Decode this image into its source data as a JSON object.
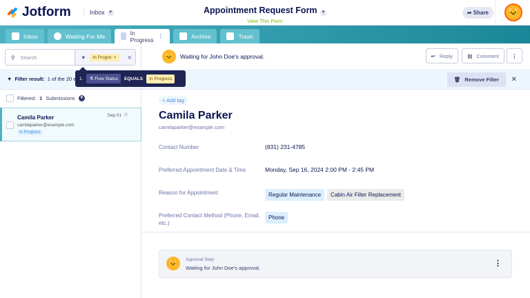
{
  "header": {
    "logo": "Jotform",
    "inbox_label": "Inbox",
    "form_title": "Appointment Request Form",
    "view_form": "View This Form",
    "share": "Share"
  },
  "tabs": [
    {
      "label": "Inbox"
    },
    {
      "label": "Waiting For Me"
    },
    {
      "label": "In Progress"
    },
    {
      "label": "Archive"
    },
    {
      "label": "Trash"
    }
  ],
  "search": {
    "placeholder": "Search",
    "filter_pill": "In Progre:"
  },
  "filter_tooltip": {
    "index": "1.",
    "field": "Flow Status",
    "op": "EQUALS",
    "value": "In Progress"
  },
  "filter_bar": {
    "label": "Filter result:",
    "text": "1 of the 20 en",
    "remove": "Remove Filter"
  },
  "list": {
    "filtered_label": "Filtered:",
    "count": "1",
    "suffix": "Submissions",
    "items": [
      {
        "name": "Camila Parker",
        "email": "camilaparker@example.com",
        "status": "In Progress",
        "date": "Sep 01"
      }
    ]
  },
  "detail": {
    "waiting": "Waiting for John Doe's approval.",
    "reply": "Reply",
    "comment": "Comment",
    "add_tag": "+ Add tag",
    "name": "Camila Parker",
    "email": "camilaparker@example.com",
    "fields": [
      {
        "label": "Contact Number",
        "value": "(831) 231-4785"
      },
      {
        "label": "Preferred Appointment Date & Time",
        "value": "Monday, Sep 16, 2024 2:00 PM - 2:45 PM"
      },
      {
        "label": "Reason for Appointment",
        "chips": [
          "Regular Maintenance",
          "Cabin Air Filter Replacement"
        ]
      },
      {
        "label": "Preferred Contact Method (Phone, Email, etc.)",
        "chips": [
          "Phone"
        ]
      }
    ],
    "approval": {
      "step": "Approval Step",
      "text": "Waiting for John Doe's approval."
    }
  }
}
